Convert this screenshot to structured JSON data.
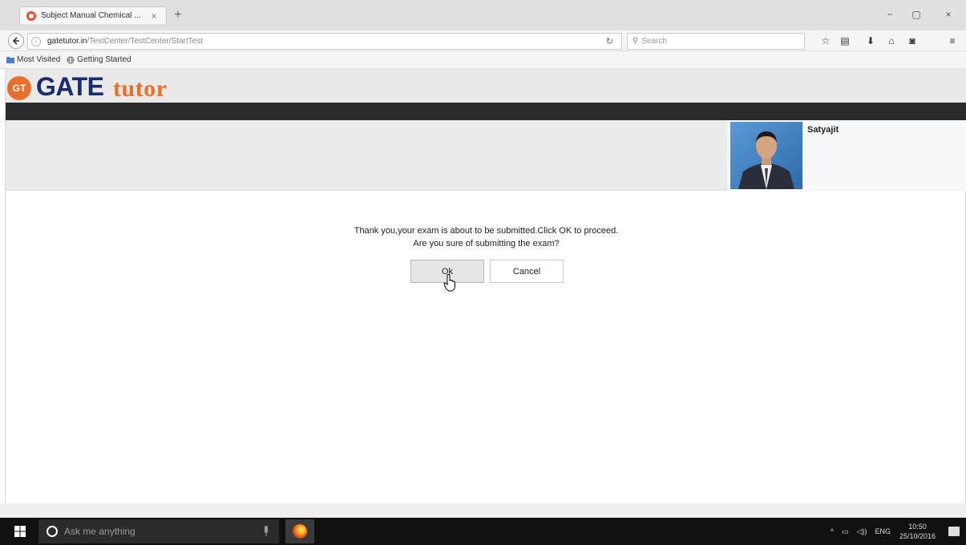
{
  "browser": {
    "tab_title": "Subject Manual Chemical ...",
    "tab_close": "×",
    "new_tab": "+",
    "win_minimize": "−",
    "win_restore": "▢",
    "win_close": "×",
    "url_domain": "gatetutor.in",
    "url_path": "/TestCenter/TestCenter/StartTest",
    "search_placeholder": "Search",
    "bookmarks": [
      "Most Visited",
      "Getting Started"
    ]
  },
  "site": {
    "logo_badge": "GT",
    "logo_gate": "GATE",
    "logo_tutor": "tutor",
    "user_name": "Satyajit"
  },
  "dialog": {
    "message_line1": "Thank you,your exam is about to be submitted.Click OK to proceed.",
    "message_line2": "Are you sure of submitting the exam?",
    "ok_label": "Ok",
    "cancel_label": "Cancel"
  },
  "taskbar": {
    "search_placeholder": "Ask me anything",
    "language": "ENG",
    "time": "10:50",
    "date": "25/10/2016"
  },
  "colors": {
    "logo_orange": "#e8702a",
    "logo_navy": "#1a2c6b",
    "header_dark": "#2a2a2a"
  }
}
